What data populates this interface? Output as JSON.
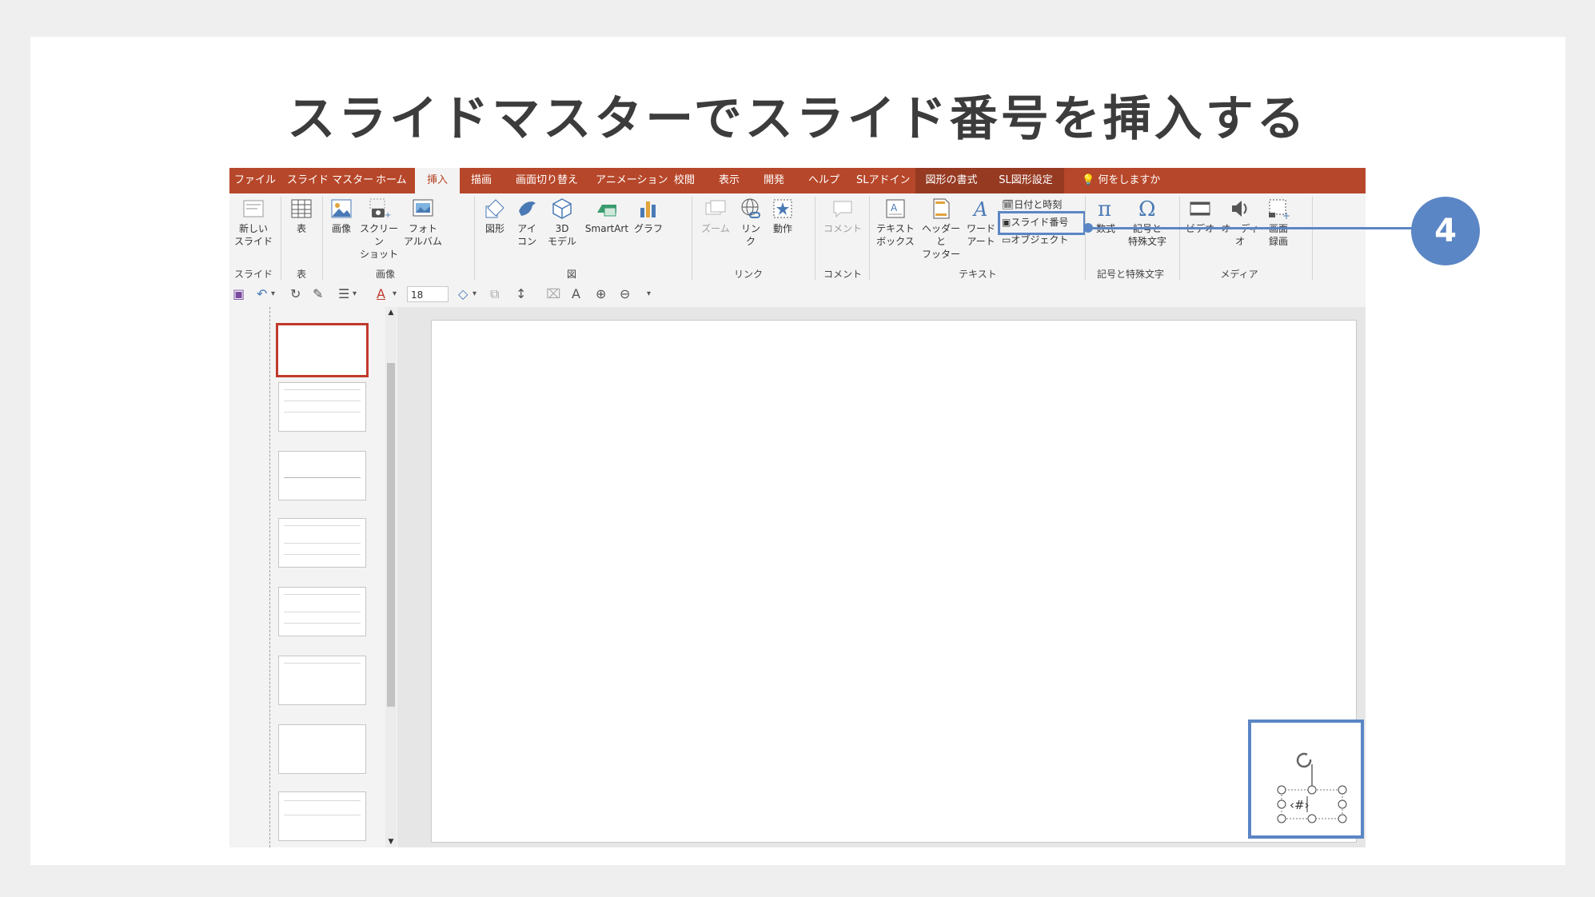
{
  "heading": "スライドマスターでスライド番号を挿入する",
  "tabs": [
    "ファイル",
    "スライド マスター",
    "ホーム",
    "挿入",
    "描画",
    "画面切り替え",
    "アニメーション",
    "校閲",
    "表示",
    "開発",
    "ヘルプ",
    "SLアドイン",
    "図形の書式",
    "SL図形設定",
    "何をしますか"
  ],
  "ribbon": {
    "new_slide": [
      "新しい",
      "スライド"
    ],
    "table": "表",
    "image": "画像",
    "screenshot": [
      "スクリーン",
      "ショット"
    ],
    "photo_album": [
      "フォト",
      "アルバム"
    ],
    "shape": "図形",
    "icon": [
      "アイ",
      "コン"
    ],
    "model3d": [
      "3D",
      "モデル"
    ],
    "smartart": "SmartArt",
    "graph": "グラフ",
    "zoom": "ズーム",
    "link": [
      "リン",
      "ク"
    ],
    "action": "動作",
    "comment": "コメント",
    "textbox": [
      "テキスト",
      "ボックス"
    ],
    "header_footer": [
      "ヘッダーと",
      "フッター"
    ],
    "wordart": [
      "ワード",
      "アート"
    ],
    "date_time": "日付と時刻",
    "slide_number": "スライド番号",
    "object": "オブジェクト",
    "equation": "数式",
    "symbol": [
      "記号と",
      "特殊文字"
    ],
    "video": "ビデオ",
    "audio": "オーディオ",
    "screen_record": [
      "画面",
      "録画"
    ],
    "groups": {
      "slide": "スライド",
      "table": "表",
      "image": "画像",
      "figure": "図",
      "link": "リンク",
      "comment": "コメント",
      "text": "テキスト",
      "symbols": "記号と特殊文字",
      "media": "メディア"
    }
  },
  "qat": {
    "font_size": "18"
  },
  "placeholder_text": "‹#›",
  "callout": "4",
  "colors": {
    "accent": "#b7472a",
    "callout": "#5b86c5"
  }
}
